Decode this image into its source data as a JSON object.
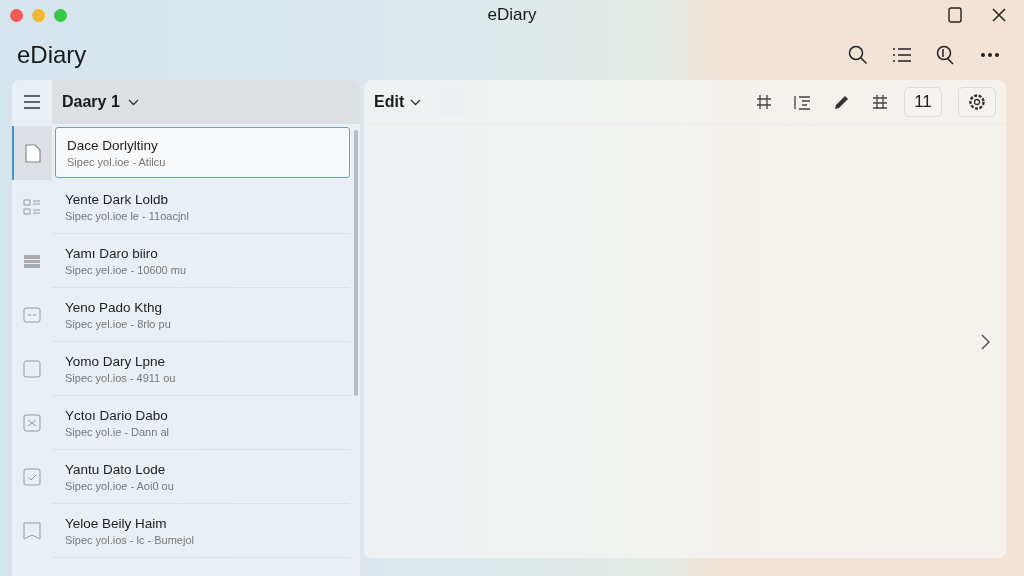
{
  "window": {
    "title": "eDiary"
  },
  "app": {
    "title": "eDiary"
  },
  "sidebar": {
    "notebook": "Daary 1",
    "entries": [
      {
        "title": "Dace Dorlyltiny",
        "subtitle": "Sipec yol.ioe - Atilcu",
        "selected": true
      },
      {
        "title": "Yente Dark Loldb",
        "subtitle": "Sipec yol.ioe  le - 11oacjnl",
        "selected": false
      },
      {
        "title": "Yamı Daro biiro",
        "subtitle": "Sipec yel.ioe - 10600 mu",
        "selected": false
      },
      {
        "title": "Yeno Pado Kthg",
        "subtitle": "Sipec yel.ioe - 8rlo pu",
        "selected": false
      },
      {
        "title": "Yomo Dary Lpne",
        "subtitle": "Sipec yol.ios - 4911 ou",
        "selected": false
      },
      {
        "title": "Yctoı Dario Dabo",
        "subtitle": "Sipec yol.ie - Dann al",
        "selected": false
      },
      {
        "title": "Yantu Dato Lode",
        "subtitle": "Sipec yol.ioe - Aoi0 ou",
        "selected": false
      },
      {
        "title": "Yeloe Beily Haim",
        "subtitle": "Sipec yol.ios - lc - Bumejol",
        "selected": false
      }
    ]
  },
  "editor": {
    "menu": "Edit",
    "font_size": "11"
  }
}
